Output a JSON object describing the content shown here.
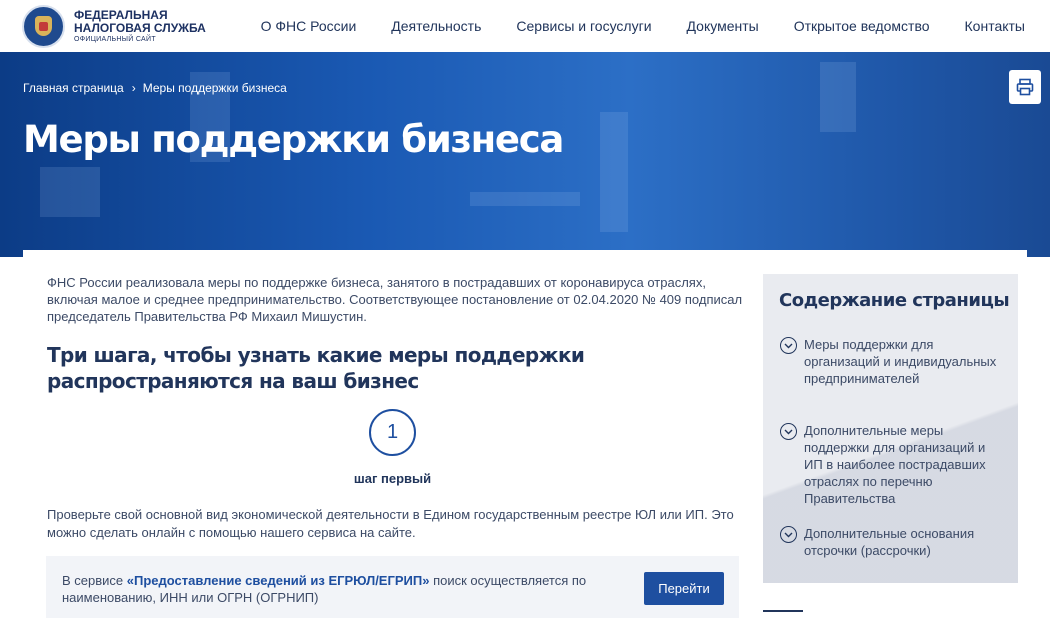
{
  "header": {
    "logo": {
      "line1": "ФЕДЕРАЛЬНАЯ",
      "line2": "НАЛОГОВАЯ СЛУЖБА",
      "line3": "ОФИЦИАЛЬНЫЙ САЙТ"
    },
    "nav": [
      {
        "label": "О ФНС России"
      },
      {
        "label": "Деятельность"
      },
      {
        "label": "Сервисы и госуслуги"
      },
      {
        "label": "Документы"
      },
      {
        "label": "Открытое ведомство"
      },
      {
        "label": "Контакты"
      }
    ]
  },
  "hero": {
    "breadcrumb": {
      "home": "Главная страница",
      "separator": "›",
      "current": "Меры поддержки бизнеса"
    },
    "title": "Меры поддержки бизнеса",
    "print_icon": "printer-icon"
  },
  "main": {
    "intro": "ФНС России реализовала меры по поддержке бизнеса, занятого в пострадавших от коронавируса отраслях, включая малое и среднее предпринимательство. Соответствующее постановление от 02.04.2020 № 409 подписал председатель Правительства РФ Михаил Мишустин.",
    "section_title": "Три шага, чтобы узнать какие меры поддержки распространяются на ваш бизнес",
    "step": {
      "number": "1",
      "label": "шаг первый",
      "text": "Проверьте свой основной вид экономической деятельности в Едином государственным реестре ЮЛ или ИП. Это можно сделать онлайн с помощью нашего сервиса на сайте."
    },
    "service": {
      "prefix": "В сервисе ",
      "name": "«Предоставление сведений из ЕГРЮЛ/ЕГРИП»",
      "suffix": " поиск осуществляется по наименованию, ИНН или ОГРН (ОГРНИП)",
      "button": "Перейти"
    }
  },
  "toc": {
    "title": "Содержание страницы",
    "items": [
      {
        "label": "Меры поддержки для организаций и индивидуальных предпринимателей",
        "icon": "chevron-down-circle-icon"
      },
      {
        "label": "Дополнительные меры поддержки для организаций и ИП в наиболее пострадавших отраслях по перечню Правительства",
        "icon": "chevron-down-circle-icon"
      },
      {
        "label": "Дополнительные основания отсрочки (рассрочки)",
        "icon": "chevron-down-circle-icon"
      }
    ]
  },
  "colors": {
    "brand_dark": "#21355b",
    "accent_blue": "#1e4fa0",
    "hero_blue": "#1a59b3",
    "toc_bg": "#e9ebf0"
  }
}
